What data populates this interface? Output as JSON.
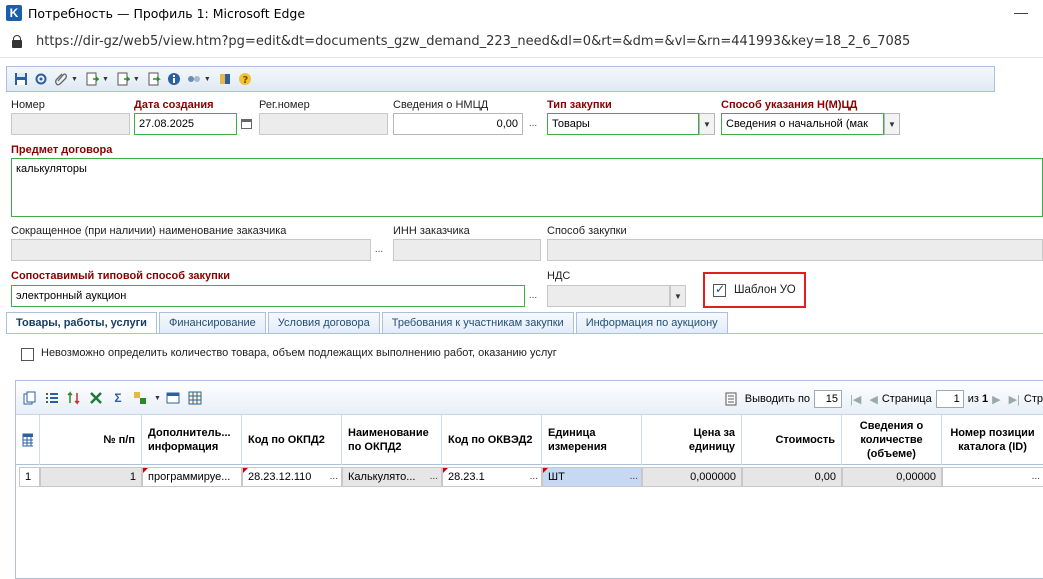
{
  "window": {
    "title": "Потребность — Профиль 1: Microsoft Edge",
    "app_letter": "K",
    "minimize": "—"
  },
  "address": {
    "url": "https://dir-gz/web5/view.htm?pg=edit&dt=documents_gzw_demand_223_need&dl=0&rt=&dm=&vl=&rn=441993&key=18_2_6_7085"
  },
  "toolbar": {
    "icons": [
      "save-icon",
      "refresh-icon",
      "attach-icon",
      "document-icon",
      "document-icon",
      "document-icon",
      "info-icon",
      "workflow-icon",
      "export-icon",
      "help-icon"
    ]
  },
  "form": {
    "nomer_label": "Номер",
    "date_label": "Дата создания",
    "date_value": "27.08.2025",
    "reg_label": "Рег.номер",
    "nmcd_label": "Сведения о НМЦД",
    "nmcd_value": "0,00",
    "type_label": "Тип закупки",
    "type_value": "Товары",
    "method_label": "Способ указания Н(М)ЦД",
    "method_value": "Сведения о начальной (мак",
    "subject_label": "Предмет договора",
    "subject_value": "калькуляторы",
    "short_name_label": "Сокращенное (при наличии) наименование заказчика",
    "inn_label": "ИНН заказчика",
    "proc_method_label": "Способ закупки",
    "typical_label": "Сопоставимый типовой способ закупки",
    "typical_value": "электронный аукцион",
    "nds_label": "НДС",
    "template_label": "Шаблон УО",
    "ellipsis": "..."
  },
  "tabs": [
    "Товары, работы, услуги",
    "Финансирование",
    "Условия договора",
    "Требования к участникам закупки",
    "Информация по аукциону"
  ],
  "qty_checkbox_label": "Невозможно определить количество товара, объем подлежащих выполнению работ, оказанию услуг",
  "grid": {
    "pager": {
      "show_label": "Выводить по",
      "show_value": "15",
      "page_label": "Страница",
      "page_value": "1",
      "of_label": "из",
      "of_value": "1",
      "more": "Стр"
    },
    "headers": [
      "№ п/п",
      "Дополнитель... информация",
      "Код по ОКПД2",
      "Наименование по ОКПД2",
      "Код по ОКВЭД2",
      "Единица измерения",
      "Цена за единицу",
      "Стоимость",
      "Сведения о количестве (объеме)",
      "Номер позиции каталога (ID)"
    ],
    "row": {
      "index": "1",
      "num": "1",
      "extra": "программируе...",
      "okpd2": "28.23.12.110",
      "okpd2_name": "Калькулято...",
      "okved2": "28.23.1",
      "unit": "ШТ",
      "price": "0,000000",
      "cost": "0,00",
      "qty": "0,00000",
      "catalog": ""
    }
  }
}
